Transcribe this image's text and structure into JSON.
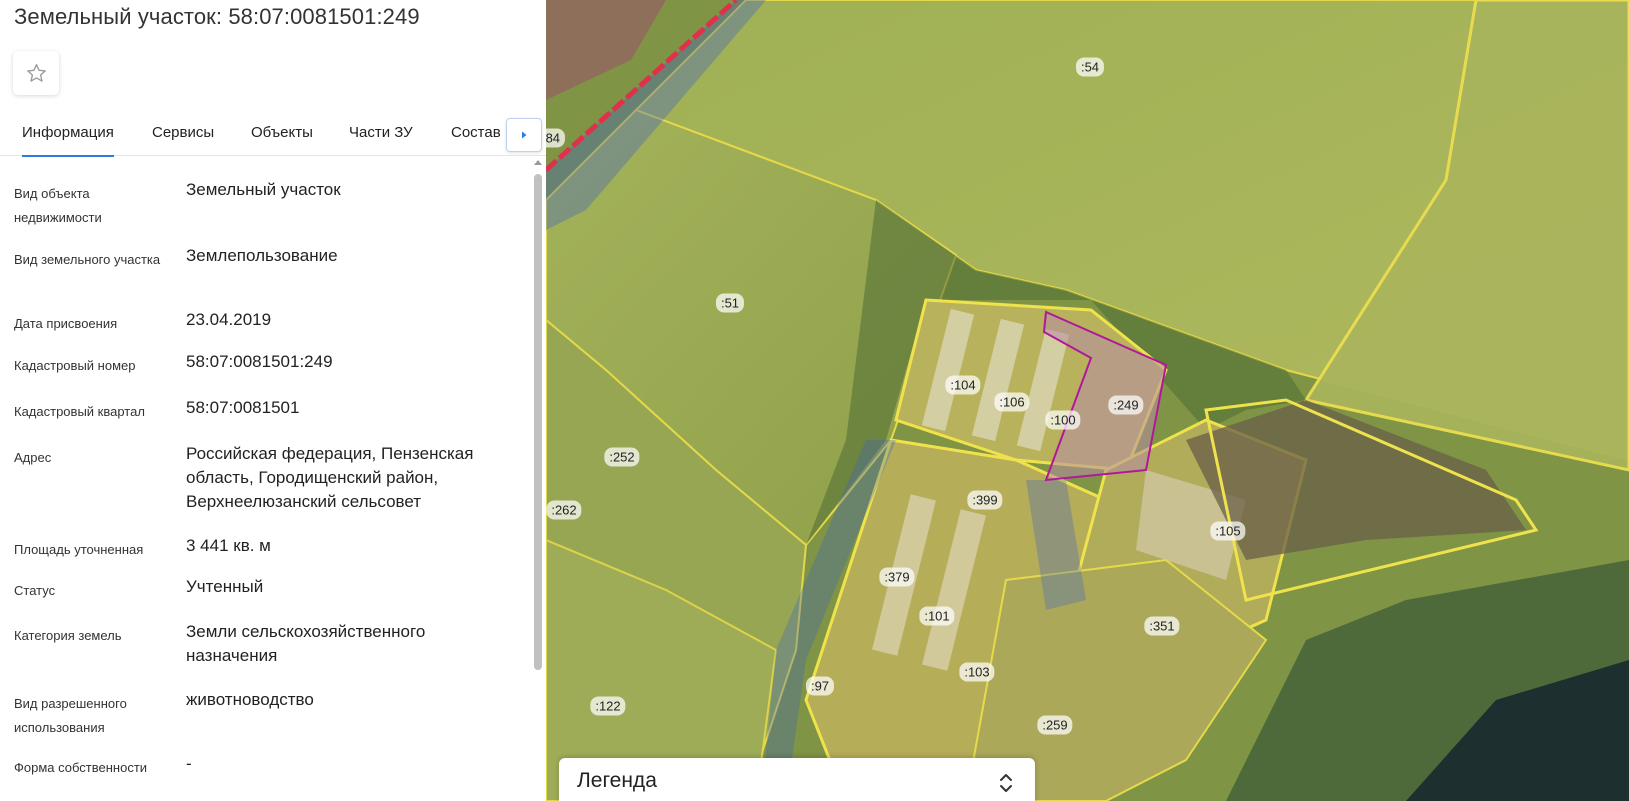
{
  "panel": {
    "title": "Земельный участок: 58:07:0081501:249",
    "favorite_icon": "star-outline-icon"
  },
  "tabs": [
    {
      "label": "Информация",
      "active": true
    },
    {
      "label": "Сервисы",
      "active": false
    },
    {
      "label": "Объекты",
      "active": false
    },
    {
      "label": "Части ЗУ",
      "active": false
    },
    {
      "label": "Состав",
      "active": false
    }
  ],
  "tabs_more_icon": "caret-right-icon",
  "info": [
    {
      "label": "Вид объекта недвижимости",
      "value": "Земельный участок"
    },
    {
      "label": "Вид земельного участка",
      "value": "Землепользование"
    },
    {
      "label": "Дата присвоения",
      "value": "23.04.2019"
    },
    {
      "label": "Кадастровый номер",
      "value": "58:07:0081501:249"
    },
    {
      "label": "Кадастровый квартал",
      "value": "58:07:0081501"
    },
    {
      "label": "Адрес",
      "value": "Российская федерация, Пензенская область, Городищенский район, Верхнеелюзанский сельсовет"
    },
    {
      "label": "Площадь уточненная",
      "value": "3 441 кв. м"
    },
    {
      "label": "Статус",
      "value": "Учтенный"
    },
    {
      "label": "Категория земель",
      "value": "Земли сельскохозяйственного назначения"
    },
    {
      "label": "Вид разрешенного использования",
      "value": "животноводство"
    },
    {
      "label": "Форма собственности",
      "value": "-"
    }
  ],
  "map": {
    "parcel_labels": [
      ":54",
      ":84",
      ":51",
      ":104",
      ":106",
      ":100",
      ":249",
      ":252",
      ":262",
      ":399",
      ":105",
      ":379",
      ":101",
      ":351",
      ":103",
      ":97",
      ":122",
      ":259"
    ],
    "colors": {
      "parcel_outline": "#f2e24a",
      "parcel_fill": "#e8d94a",
      "selected_outline": "#b0189c",
      "road_overlay": "#3b5fc8",
      "red_zone": "#e0304a",
      "water": "#1a2c2c"
    }
  },
  "legend": {
    "title": "Легенда",
    "toggle_icon": "chevron-up-down-icon"
  }
}
